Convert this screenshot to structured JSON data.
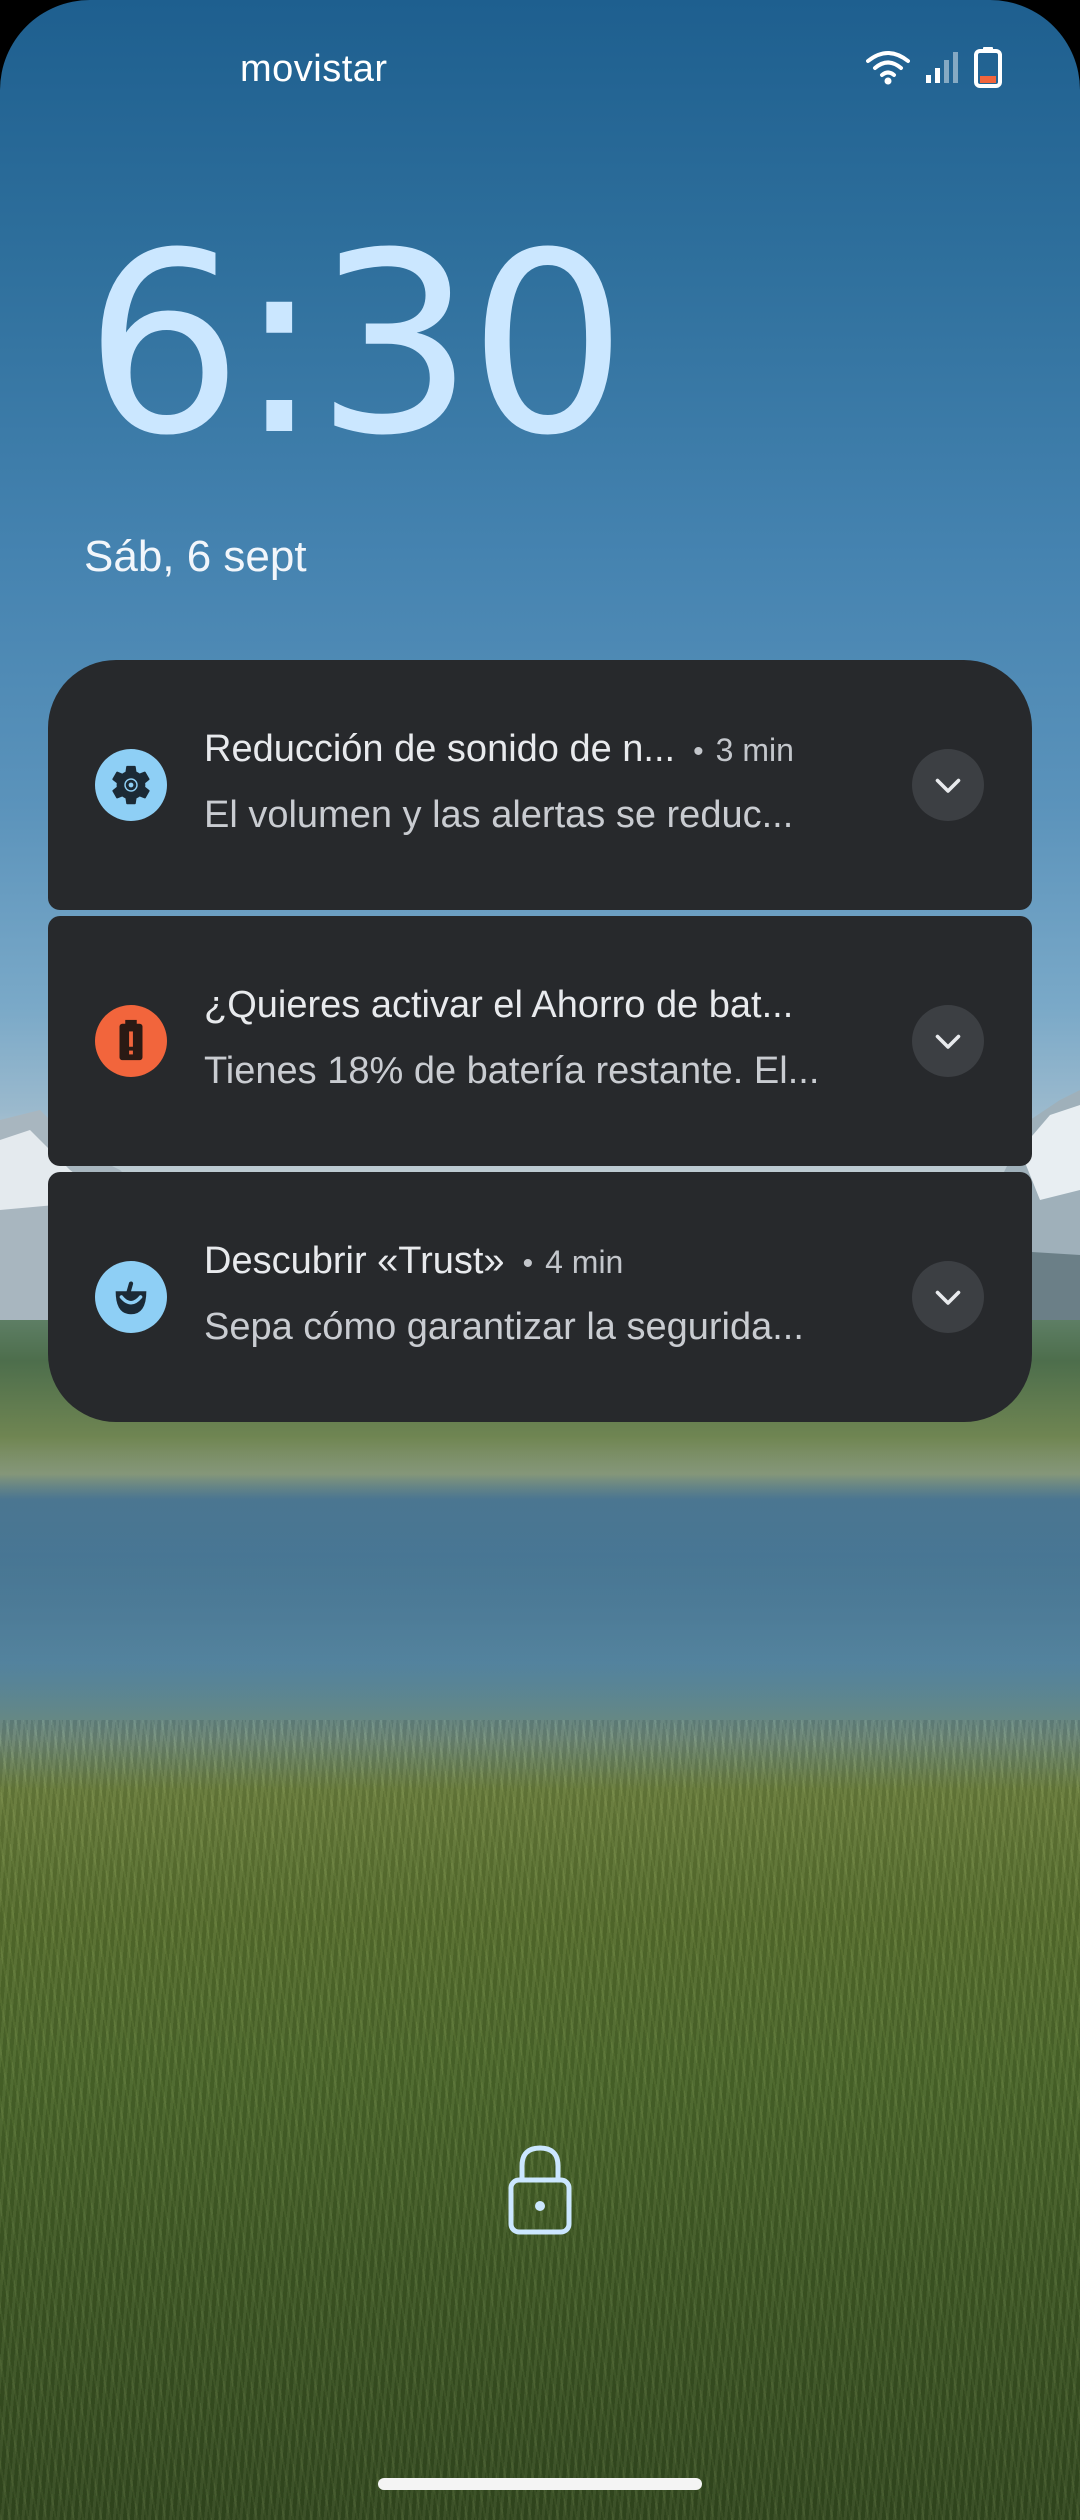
{
  "status_bar": {
    "carrier": "movistar",
    "icons": [
      "wifi-icon",
      "cell-signal-icon",
      "battery-low-icon"
    ]
  },
  "lockscreen": {
    "clock": "6:30",
    "date": "Sáb, 6 sept"
  },
  "notifications": [
    {
      "icon": "gear-icon",
      "icon_bg": "#8ecff5",
      "title": "Reducción de sonido de n...",
      "time": "3 min",
      "body": "El volumen y las alertas se reduc..."
    },
    {
      "icon": "battery-alert-icon",
      "icon_bg": "#f2653c",
      "title": "¿Quieres activar el Ahorro de bat...",
      "time": "",
      "body": "Tienes 18% de batería restante. El..."
    },
    {
      "icon": "trust-smile-icon",
      "icon_bg": "#8ecff5",
      "title": "Descubrir «Trust»",
      "time": "4 min",
      "body": "Sepa cómo garantizar la segurida..."
    }
  ],
  "bottom": {
    "lock_icon": "lock-icon",
    "nav": "navigation-handle"
  },
  "colors": {
    "clock": "#cbe7ff",
    "card": "#27292c",
    "accent_blue": "#8ecff5",
    "alert_orange": "#f2653c"
  }
}
